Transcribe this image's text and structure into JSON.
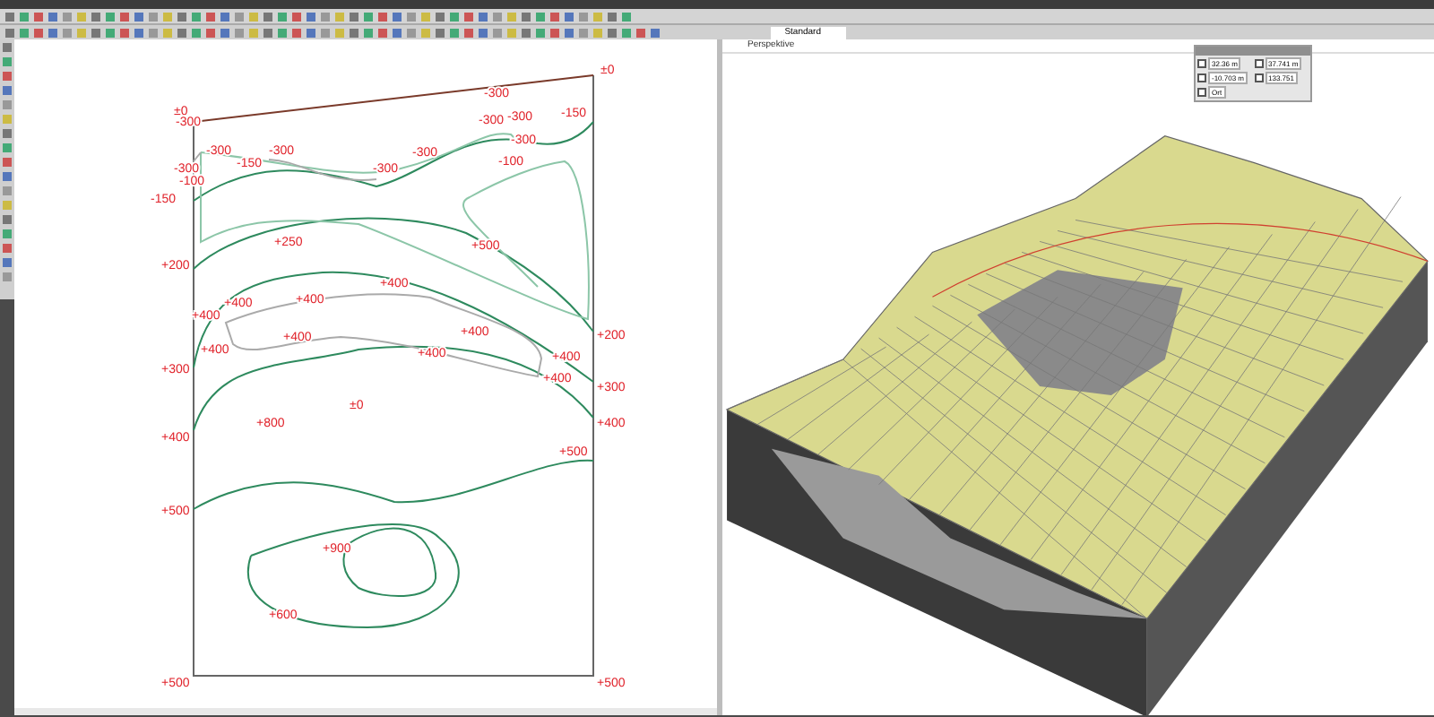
{
  "tabs": [
    {
      "label": "Standard",
      "selected": true
    }
  ],
  "view_3d": {
    "title": "Perspektive"
  },
  "panel": {
    "fields": [
      {
        "value": "32.36 m",
        "checked": false
      },
      {
        "value": "37.741 m",
        "checked": false
      },
      {
        "value": "-10.703 m",
        "checked": false
      },
      {
        "value": "133.751",
        "checked": false
      },
      {
        "value": "Ort",
        "checked": false
      }
    ]
  },
  "plan": {
    "labels": [
      "±0",
      "-300",
      "-300",
      "±0",
      "-300",
      "-300",
      "-150",
      "-300",
      "-300",
      "-300",
      "-300",
      "-150",
      "-100",
      "-150",
      "-300",
      "-300",
      "-100",
      "+250",
      "+500",
      "+200",
      "+400",
      "+400",
      "+400",
      "+400",
      "+400",
      "+400",
      "+400",
      "+400",
      "+400",
      "+400",
      "+200",
      "+300",
      "+300",
      "±0",
      "+800",
      "+400",
      "+400",
      "+500",
      "+500",
      "+900",
      "+600",
      "+500",
      "+500"
    ]
  }
}
